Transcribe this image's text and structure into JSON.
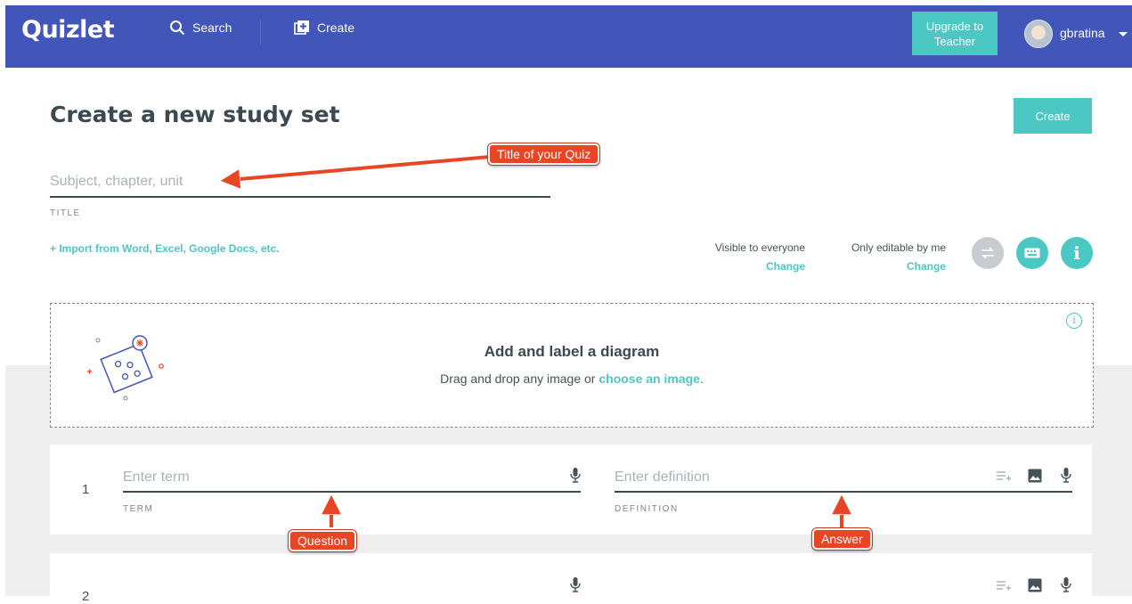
{
  "header": {
    "logo": "Quizlet",
    "search_label": "Search",
    "create_label": "Create",
    "upgrade_label": "Upgrade to\nTeacher",
    "username": "gbratina"
  },
  "page": {
    "title": "Create a new study set",
    "create_button": "Create",
    "title_placeholder": "Subject, chapter, unit",
    "title_label": "TITLE",
    "import_link": "+ Import from Word, Excel, Google Docs, etc.",
    "visibility": {
      "label": "Visible to everyone",
      "action": "Change"
    },
    "editability": {
      "label": "Only editable by me",
      "action": "Change"
    }
  },
  "diagram": {
    "title": "Add and label a diagram",
    "text_before": "Drag and drop any image or ",
    "link": "choose an image",
    "text_after": ".",
    "info": "i"
  },
  "cards": [
    {
      "number": "1",
      "term_placeholder": "Enter term",
      "term_label": "TERM",
      "definition_placeholder": "Enter definition",
      "definition_label": "DEFINITION"
    },
    {
      "number": "2"
    }
  ],
  "annotations": {
    "title_callout": "Title of your Quiz",
    "question_callout": "Question",
    "answer_callout": "Answer"
  },
  "colors": {
    "header": "#4255b8",
    "accent": "#4bc8c4",
    "callout": "#e84524"
  }
}
